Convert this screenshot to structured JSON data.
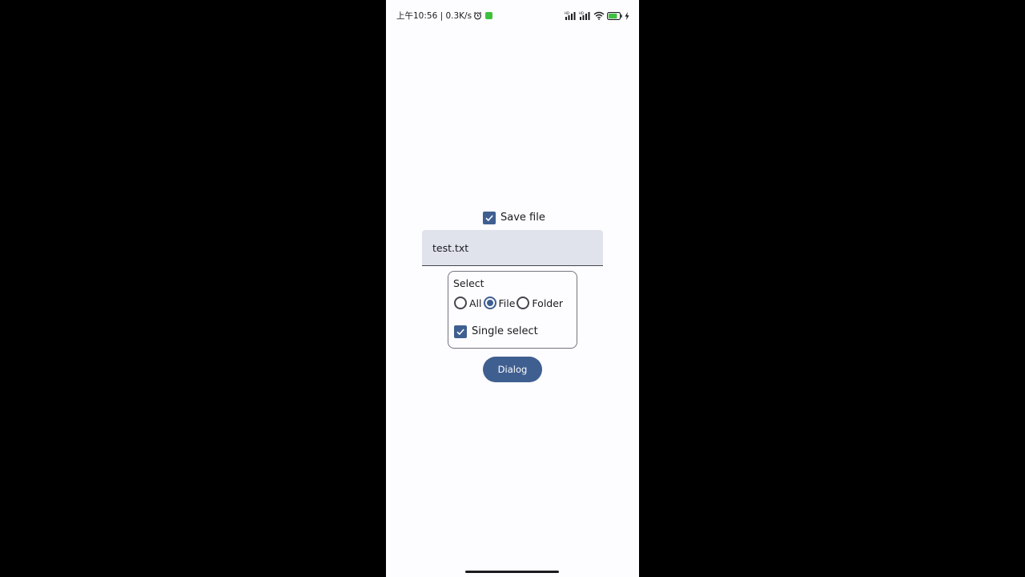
{
  "status_bar": {
    "time_network": "上午10:56 | 0.3K/s",
    "icons": [
      "alarm-icon",
      "notification-badge",
      "hd-signal-icon",
      "hd-signal-icon",
      "wifi-icon",
      "battery-icon",
      "charging-icon"
    ]
  },
  "save_file": {
    "label": "Save file",
    "checked": true
  },
  "filename_field": {
    "value": "test.txt"
  },
  "select_group": {
    "title": "Select",
    "options": [
      {
        "label": "All",
        "selected": false
      },
      {
        "label": "File",
        "selected": true
      },
      {
        "label": "Folder",
        "selected": false
      }
    ],
    "single_select": {
      "label": "Single select",
      "checked": true
    }
  },
  "dialog_button": {
    "label": "Dialog"
  },
  "colors": {
    "accent": "#3f5f90",
    "surface": "#fdfcff",
    "field_background": "#e0e2ec",
    "on_surface": "#1b1b1f",
    "outline": "#74777f"
  }
}
